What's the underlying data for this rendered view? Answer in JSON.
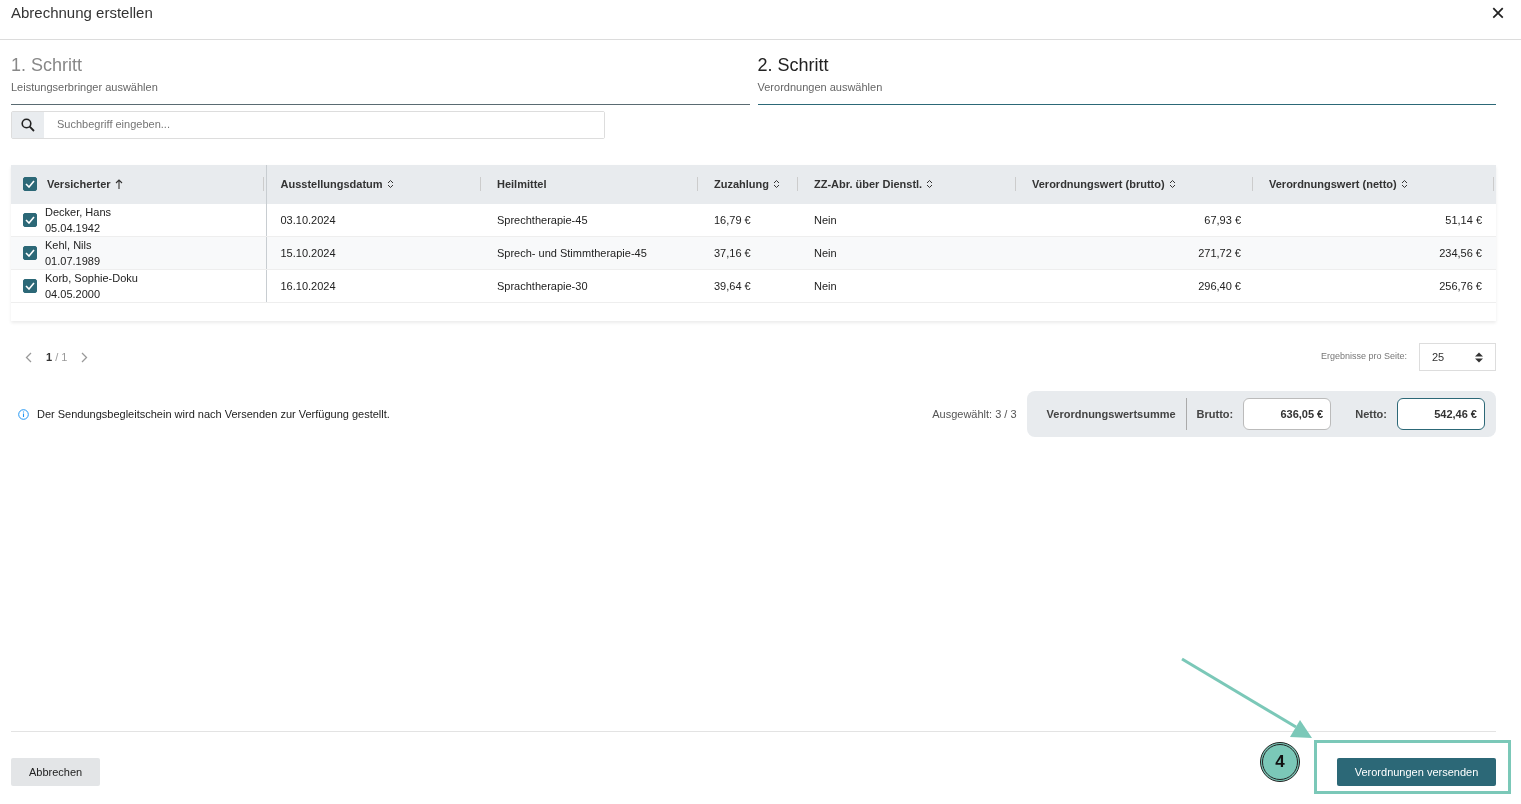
{
  "dialog": {
    "title": "Abrechnung erstellen",
    "close": "×"
  },
  "steps": [
    {
      "title": "1. Schritt",
      "subtitle": "Leistungserbringer auswählen",
      "selected": false
    },
    {
      "title": "2. Schritt",
      "subtitle": "Verordnungen auswählen",
      "selected": true
    }
  ],
  "search": {
    "placeholder": "Suchbegriff eingeben..."
  },
  "table": {
    "all_checked": true,
    "columns": [
      {
        "label": "Versicherter",
        "kind": "ascending"
      },
      {
        "label": "Ausstellungsdatum",
        "kind": "sortable"
      },
      {
        "label": "Heilmittel",
        "kind": "plain"
      },
      {
        "label": "Zuzahlung",
        "kind": "sortable"
      },
      {
        "label": "ZZ-Abr. über Dienstl.",
        "kind": "sortable"
      },
      {
        "label": "Verordnungswert (brutto)",
        "kind": "sortable"
      },
      {
        "label": "Verordnungswert (netto)",
        "kind": "sortable"
      }
    ],
    "rows": [
      {
        "checked": true,
        "cells": [
          "Decker, Hans\n05.04.1942",
          "03.10.2024",
          "Sprechtherapie-45",
          "16,79 €",
          "Nein",
          "67,93 €",
          "51,14 €"
        ]
      },
      {
        "checked": true,
        "cells": [
          "Kehl, Nils\n01.07.1989",
          "15.10.2024",
          "Sprech- und Stimmtherapie-45",
          "37,16 €",
          "Nein",
          "271,72 €",
          "234,56 €"
        ]
      },
      {
        "checked": true,
        "cells": [
          "Korb, Sophie-Doku\n04.05.2000",
          "16.10.2024",
          "Sprachtherapie-30",
          "39,64 €",
          "Nein",
          "296,40 €",
          "256,76 €"
        ]
      }
    ]
  },
  "pagination": {
    "current": "1",
    "separator": "/",
    "total": "1",
    "page_size_label": "Ergebnisse pro Seite:",
    "page_size": "25"
  },
  "info": "Der Sendungsbegleitschein wird nach Versenden zur Verfügung gestellt.",
  "summary": {
    "selected": "Ausgewählt: 3 / 3",
    "label": "Verordnungswertsumme",
    "brutto_label": "Brutto:",
    "brutto": "636,05 €",
    "netto_label": "Netto:",
    "netto": "542,46 €"
  },
  "buttons": {
    "cancel": "Abbrechen",
    "submit": "Verordnungen versenden"
  },
  "annotation": {
    "step_number": "4"
  }
}
